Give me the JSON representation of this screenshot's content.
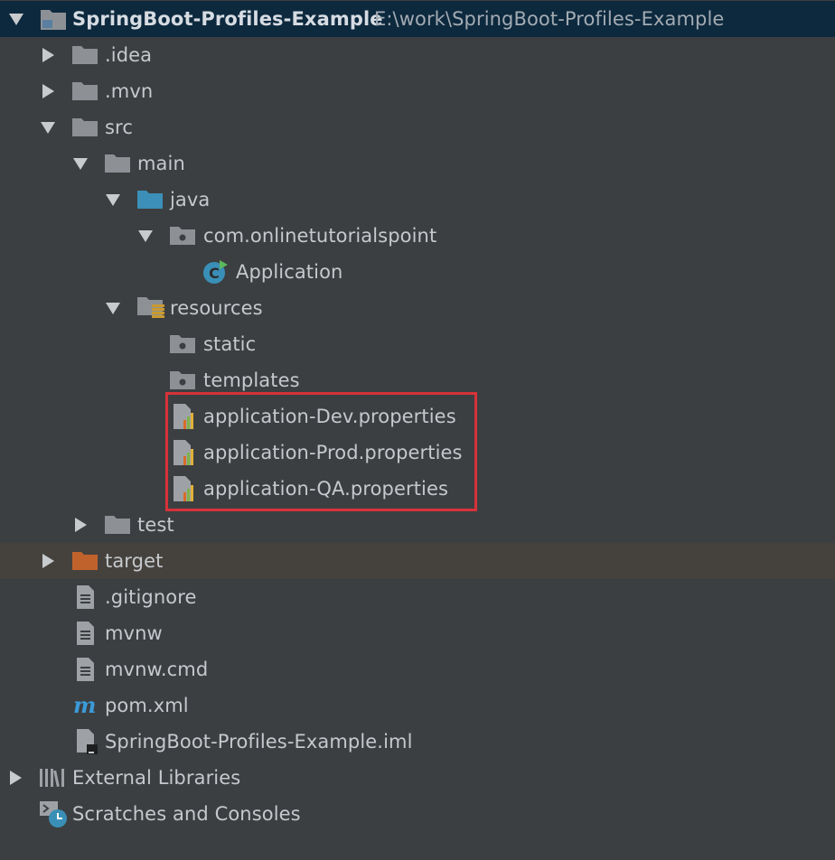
{
  "project": {
    "name": "SpringBoot-Profiles-Example",
    "path": "E:\\work\\SpringBoot-Profiles-Example"
  },
  "tree": {
    "idea": ".idea",
    "mvn": ".mvn",
    "src": "src",
    "main": "main",
    "java": "java",
    "package": "com.onlinetutorialspoint",
    "application_class": "Application",
    "resources": "resources",
    "static": "static",
    "templates": "templates",
    "props_dev": "application-Dev.properties",
    "props_prod": "application-Prod.properties",
    "props_qa": "application-QA.properties",
    "test": "test",
    "target": "target",
    "gitignore": ".gitignore",
    "mvnw": "mvnw",
    "mvnw_cmd": "mvnw.cmd",
    "pom": "pom.xml",
    "iml": "SpringBoot-Profiles-Example.iml",
    "external_libraries": "External Libraries",
    "scratches": "Scratches and Consoles"
  },
  "colors": {
    "folder": "#8d9195",
    "source_folder": "#3c8fb8",
    "target_folder": "#c0622c",
    "highlight": "#d7323a",
    "maven": "#3b9ad9"
  }
}
